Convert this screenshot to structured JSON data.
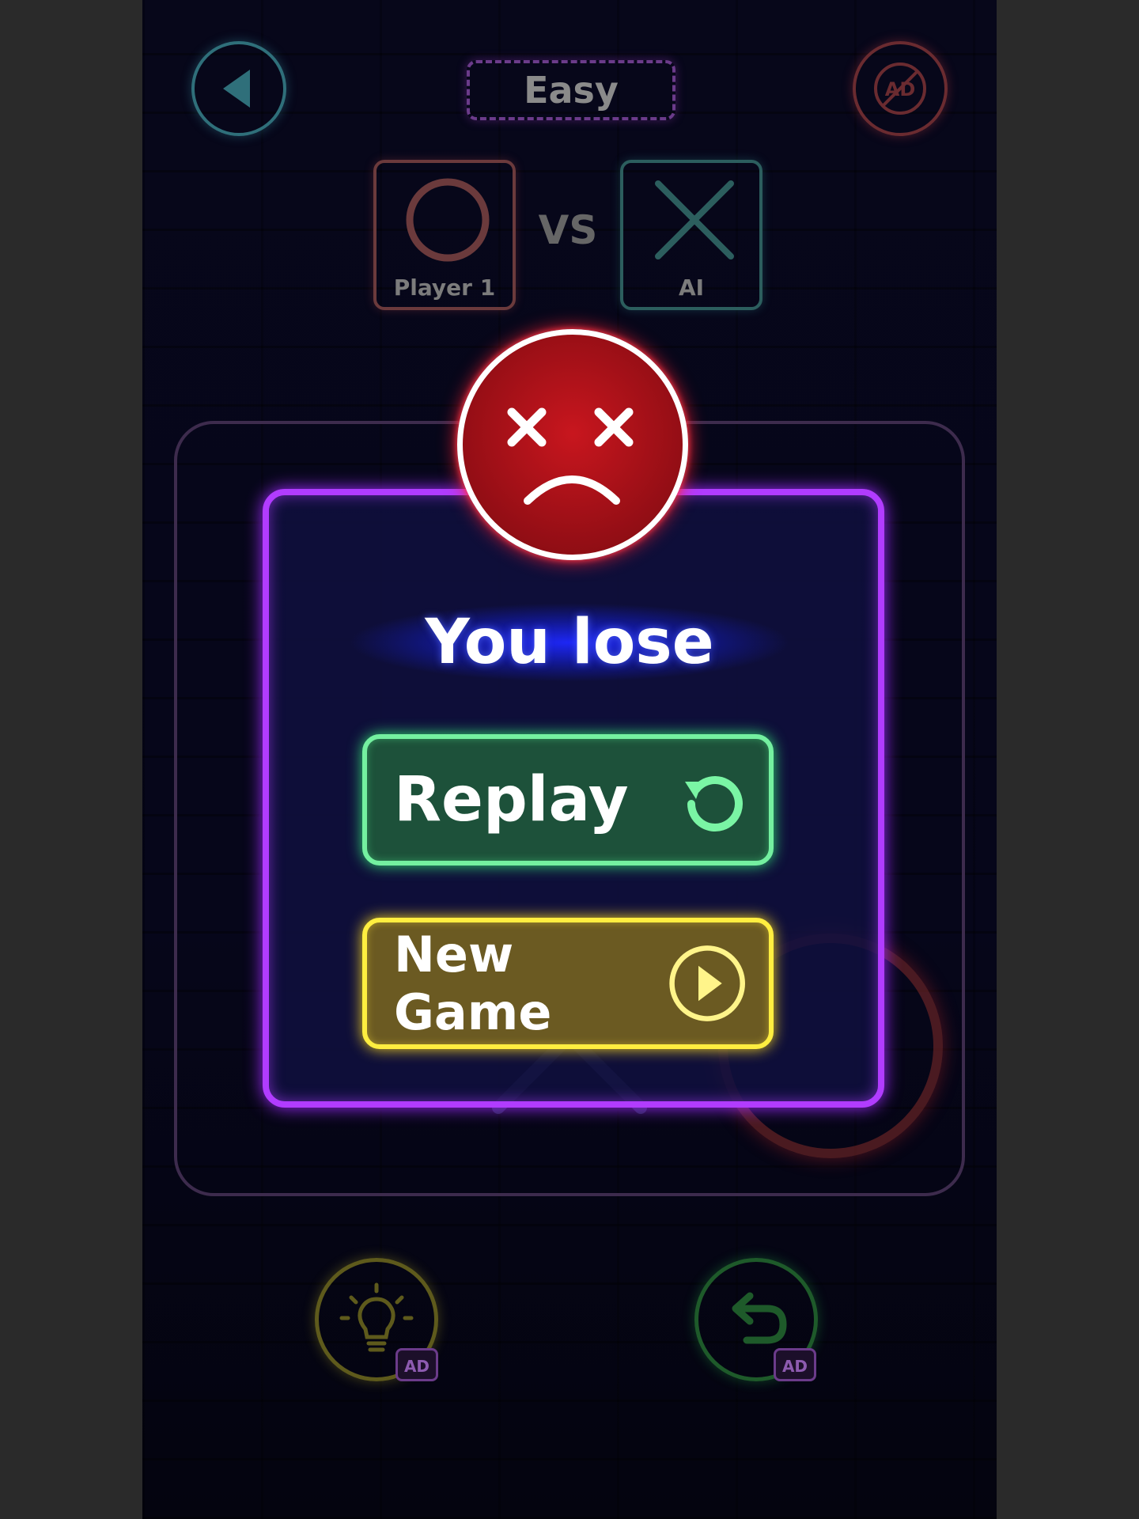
{
  "top_bar": {
    "level": "Easy",
    "back_icon": "back-triangle-icon",
    "no_ads_icon": "no-ads-icon",
    "no_ads_label": "AD"
  },
  "players": {
    "player1": {
      "name": "Player 1",
      "symbol": "O"
    },
    "vs_label": "VS",
    "opponent": {
      "name": "AI",
      "symbol": "X"
    }
  },
  "dialog": {
    "result": "You lose",
    "replay_label": "Replay",
    "new_game_label": "New Game",
    "face_icon": "sad-face-icon"
  },
  "bottom": {
    "hint_ad_label": "AD",
    "undo_ad_label": "AD"
  },
  "colors": {
    "dialog_border": "#b13cff",
    "replay_border": "#74f0a0",
    "new_game_border": "#ffee40",
    "face_red": "#c8161e"
  }
}
